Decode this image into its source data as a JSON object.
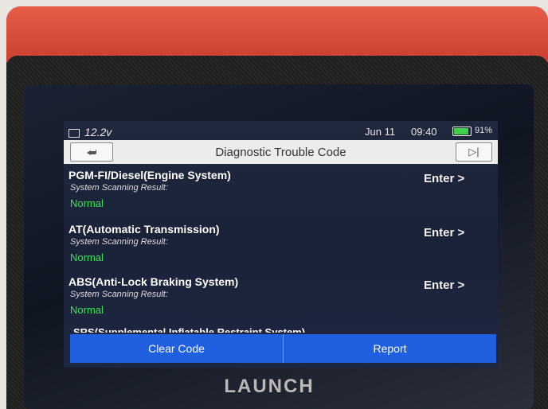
{
  "device": {
    "brand": "LAUNCH"
  },
  "status_bar": {
    "voltage": "12.2v",
    "date": "Jun 11",
    "time": "09:40",
    "battery_percent": "91%",
    "battery_level": 0.91,
    "battery_color": "#3fd14b"
  },
  "header": {
    "title": "Diagnostic Trouble Code",
    "back_icon": "back-arrow-icon",
    "exit_icon": "exit-icon"
  },
  "systems": [
    {
      "name": "PGM-FI/Diesel(Engine System)",
      "label": "System Scanning Result:",
      "status": "Normal",
      "action": "Enter >"
    },
    {
      "name": "AT(Automatic Transmission)",
      "label": "System Scanning Result:",
      "status": "Normal",
      "action": "Enter >"
    },
    {
      "name": "ABS(Anti-Lock Braking System)",
      "label": "System Scanning Result:",
      "status": "Normal",
      "action": "Enter >"
    }
  ],
  "partial_item": "SRS(Supplemental Inflatable Restraint System)",
  "footer": {
    "clear_code": "Clear Code",
    "report": "Report"
  },
  "colors": {
    "accent": "#1f5fe0",
    "status_normal": "#3ee05a"
  }
}
